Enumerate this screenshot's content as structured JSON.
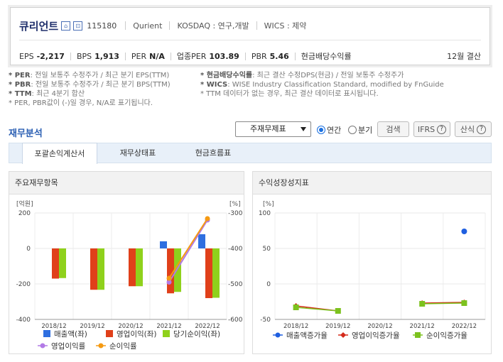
{
  "header": {
    "company": "큐리언트",
    "code": "115180",
    "english_name": "Qurient",
    "market": "KOSDAQ : 연구,개발",
    "wics": "WICS : 제약",
    "settlement": "12월 결산",
    "metrics": [
      {
        "label": "EPS",
        "value": "-2,217"
      },
      {
        "label": "BPS",
        "value": "1,913"
      },
      {
        "label": "PER",
        "value": "N/A"
      },
      {
        "label": "업종PER",
        "value": "103.89"
      },
      {
        "label": "PBR",
        "value": "5.46"
      },
      {
        "label": "현금배당수익률",
        "value": ""
      }
    ]
  },
  "notes": {
    "left": [
      {
        "key": "* PER",
        "text": ": 전일 보통주 수정주가 / 최근 분기 EPS(TTM)"
      },
      {
        "key": "* PBR",
        "text": ": 전일 보통주 수정주가 / 최근 분기 BPS(TTM)"
      },
      {
        "key": "* TTM",
        "text": ": 최근 4분기 합산"
      },
      {
        "key": "",
        "text": "* PER, PBR값이 (-)일 경우, N/A로 표기됩니다."
      }
    ],
    "right": [
      {
        "key": "* 현금배당수익률",
        "text": ": 최근 결산 수정DPS(현금) / 전일 보통주 수정주가"
      },
      {
        "key": "* WICS",
        "text": ": WISE Industry Classification Standard, modified by FnGuide"
      },
      {
        "key": "",
        "text": "* TTM 데이터가 없는 경우, 최근 결산 데이터로 표시됩니다."
      }
    ]
  },
  "analysis": {
    "title": "재무분석",
    "select_value": "주재무제표",
    "radio_annual": "연간",
    "radio_quarter": "분기",
    "search_button": "검색",
    "ifrs_button": "IFRS",
    "formula_button": "산식",
    "tabs": [
      "포괄손익계산서",
      "재무상태표",
      "현금흐름표"
    ]
  },
  "colors": {
    "revenue": "#2f6fe0",
    "op_income": "#e0401a",
    "net_income": "#8fd11c",
    "op_margin": "#b27ae6",
    "net_margin": "#f59a12",
    "growth_rev": "#1f5fe0",
    "growth_op": "#d42a1a",
    "growth_net": "#7cc21e"
  },
  "chart_data": [
    {
      "type": "bar",
      "title": "주요재무항목",
      "y_unit_left": "[억원]",
      "y_unit_right": "[%]",
      "categories": [
        "2018/12",
        "2019/12",
        "2020/12",
        "2021/12",
        "2022/12"
      ],
      "ylim": [
        -400,
        200
      ],
      "yticks": [
        200,
        0,
        -200,
        -400
      ],
      "y2lim": [
        -600,
        -300
      ],
      "y2ticks": [
        -300,
        -400,
        -500,
        -600
      ],
      "series": [
        {
          "name": "매출액(좌)",
          "kind": "bar",
          "values": [
            null,
            null,
            null,
            40,
            80
          ]
        },
        {
          "name": "영업이익(좌)",
          "kind": "bar",
          "values": [
            -170,
            -233,
            -213,
            -253,
            -280
          ]
        },
        {
          "name": "당기순이익(좌)",
          "kind": "bar",
          "values": [
            -167,
            -233,
            -213,
            -245,
            -278
          ]
        },
        {
          "name": "영업이익률",
          "kind": "line",
          "axis": "right",
          "values": [
            null,
            null,
            null,
            -495,
            -320
          ]
        },
        {
          "name": "순이익률",
          "kind": "line",
          "axis": "right",
          "values": [
            null,
            null,
            null,
            -484,
            -316
          ]
        }
      ]
    },
    {
      "type": "line",
      "title": "수익성장성지표",
      "y_unit": "[%]",
      "categories": [
        "2018/12",
        "2019/12",
        "2020/12",
        "2021/12",
        "2022/12"
      ],
      "ylim": [
        -50,
        100
      ],
      "yticks": [
        100,
        50,
        0,
        -50
      ],
      "series": [
        {
          "name": "매출액증가율",
          "values": [
            null,
            null,
            null,
            null,
            74
          ]
        },
        {
          "name": "영업이익증가율",
          "values": [
            -31,
            -38,
            null,
            -27,
            -26
          ]
        },
        {
          "name": "순이익증가율",
          "values": [
            -33,
            -38,
            null,
            -28,
            -27
          ]
        }
      ]
    }
  ]
}
